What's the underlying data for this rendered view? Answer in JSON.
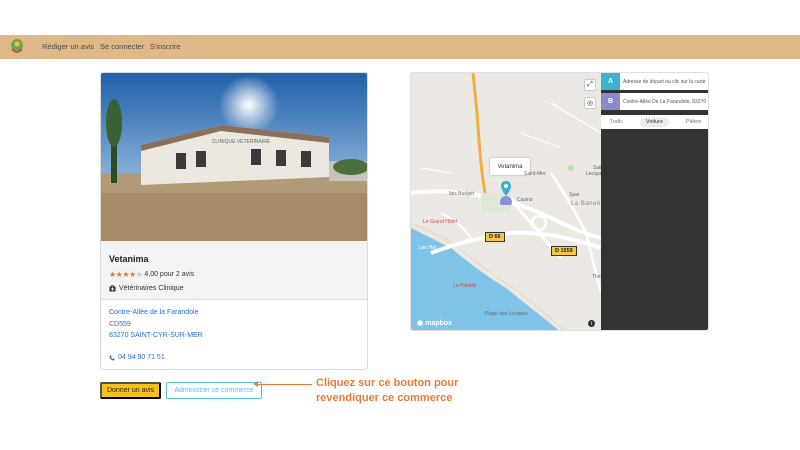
{
  "nav": {
    "links": [
      "Rédiger un avis",
      "Se connecter",
      "S'inscrire"
    ]
  },
  "business": {
    "name": "Vetanima",
    "rating_value": 4,
    "rating_max": 5,
    "rating_text": "4,00 pour 2 avis",
    "category": "Vétérinaires Clinique",
    "address_line1": "Contre-Allée de la Farandole",
    "address_line2": "CD559",
    "address_line3": "83270 SAINT-CYR-SUR-MER",
    "phone": "04 94 90 71 51",
    "photo_sign": "CLINIQUE VETERINAIRE"
  },
  "actions": {
    "give_review": "Donner un avis",
    "admin": "Administrer ce commerce"
  },
  "callout": {
    "line1": "Cliquez sur ce bouton pour",
    "line2": "revendiquer ce commerce"
  },
  "map": {
    "popup": "Vetanima",
    "labels": [
      "Ibis Budget",
      "Saint-Mer",
      "Casino",
      "Spar",
      "Le Grand Hôtel",
      "La Baneti",
      "Lecques",
      "Les Hal",
      "La Pataille",
      "Plage des Lecques",
      "Théâ",
      "Saint-"
    ],
    "road_d66": "D 66",
    "road_d1559": "D 1559",
    "attribution": "mapbox",
    "directions": {
      "a_label": "A",
      "a_placeholder": "Adresse de départ ou clic sur la carte",
      "b_label": "B",
      "b_value": "Contre-Allée De La Farandole, 83270",
      "modes": [
        "Trafic",
        "Voiture",
        "Piéton"
      ],
      "active_mode": "Voiture"
    }
  },
  "colors": {
    "navbar": "#deb887",
    "accent": "#e87b3a",
    "link": "#2a6fc9",
    "button_yellow": "#f5c11b",
    "button_outline": "#5bc0de"
  }
}
